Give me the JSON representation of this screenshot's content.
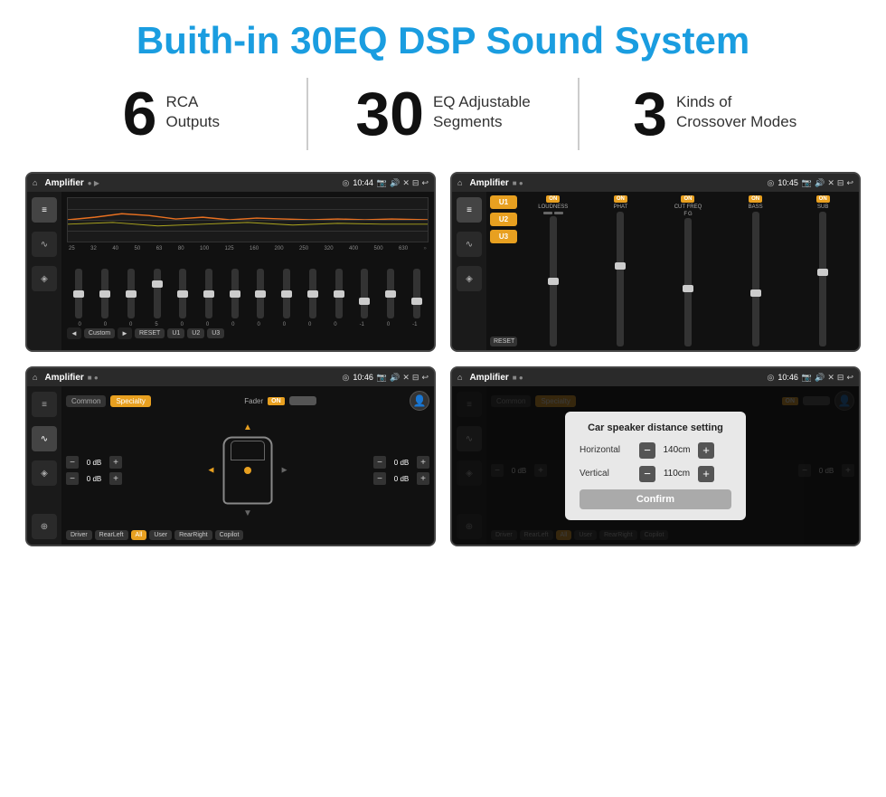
{
  "header": {
    "title": "Buith-in 30EQ DSP Sound System"
  },
  "stats": [
    {
      "number": "6",
      "text": "RCA\nOutputs"
    },
    {
      "number": "30",
      "text": "EQ Adjustable\nSegments"
    },
    {
      "number": "3",
      "text": "Kinds of\nCrossover Modes"
    }
  ],
  "screen1": {
    "topbar": {
      "title": "Amplifier",
      "time": "10:44"
    },
    "eq_freqs": [
      "25",
      "32",
      "40",
      "50",
      "63",
      "80",
      "100",
      "125",
      "160",
      "200",
      "250",
      "320",
      "400",
      "500",
      "630"
    ],
    "eq_values": [
      "0",
      "0",
      "0",
      "5",
      "0",
      "0",
      "0",
      "0",
      "0",
      "0",
      "0",
      "-1",
      "0",
      "-1"
    ],
    "buttons": [
      "Custom",
      "RESET",
      "U1",
      "U2",
      "U3"
    ]
  },
  "screen2": {
    "topbar": {
      "title": "Amplifier",
      "time": "10:45"
    },
    "u_buttons": [
      "U1",
      "U2",
      "U3"
    ],
    "controls": [
      {
        "label": "LOUDNESS",
        "on": true
      },
      {
        "label": "PHAT",
        "on": true
      },
      {
        "label": "CUT FREQ",
        "on": true
      },
      {
        "label": "BASS",
        "on": true
      },
      {
        "label": "SUB",
        "on": true
      }
    ],
    "reset": "RESET"
  },
  "screen3": {
    "topbar": {
      "title": "Amplifier",
      "time": "10:46"
    },
    "tabs": [
      "Common",
      "Specialty"
    ],
    "fader_label": "Fader",
    "fader_on": "ON",
    "db_values": [
      "0 dB",
      "0 dB",
      "0 dB",
      "0 dB"
    ],
    "bottom_buttons": [
      "Driver",
      "RearLeft",
      "All",
      "User",
      "RearRight",
      "Copilot"
    ]
  },
  "screen4": {
    "topbar": {
      "title": "Amplifier",
      "time": "10:46"
    },
    "tabs": [
      "Common",
      "Specialty"
    ],
    "modal": {
      "title": "Car speaker distance setting",
      "rows": [
        {
          "label": "Horizontal",
          "value": "140cm"
        },
        {
          "label": "Vertical",
          "value": "110cm"
        }
      ],
      "confirm_label": "Confirm"
    },
    "side_values": [
      "0 dB",
      "0 dB"
    ],
    "bottom_buttons": [
      "Driver",
      "RearLeft",
      "All",
      "User",
      "RearRight",
      "Copilot"
    ]
  },
  "icons": {
    "home": "⌂",
    "location": "◎",
    "speaker": "♪",
    "back": "↩",
    "camera": "📷",
    "eq_icon": "≡",
    "wave_icon": "∿",
    "speaker_icon": "🔊",
    "person_icon": "👤",
    "arrow_up": "▲",
    "arrow_down": "▼",
    "arrow_left": "◄",
    "arrow_right": "►",
    "chevron_down": "▼",
    "car_icon": "🚗"
  }
}
